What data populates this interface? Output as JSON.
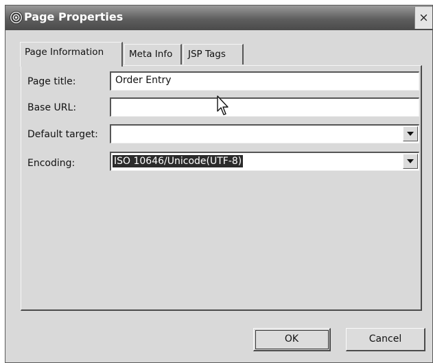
{
  "window": {
    "title": "Page Properties",
    "close_label": "×"
  },
  "tabs": [
    {
      "label": "Page Information",
      "active": true
    },
    {
      "label": "Meta Info",
      "active": false
    },
    {
      "label": "JSP Tags",
      "active": false
    }
  ],
  "form": {
    "page_title": {
      "label": "Page title:",
      "value": "Order Entry"
    },
    "base_url": {
      "label": "Base URL:",
      "value": ""
    },
    "default_target": {
      "label": "Default target:",
      "value": ""
    },
    "encoding": {
      "label": "Encoding:",
      "value": "ISO 10646/Unicode(UTF-8)"
    }
  },
  "buttons": {
    "ok_label": "OK",
    "cancel_label": "Cancel"
  },
  "icons": {
    "app": "app-logo-icon",
    "dropdown": "chevron-down-icon",
    "cursor": "mouse-pointer-icon"
  }
}
